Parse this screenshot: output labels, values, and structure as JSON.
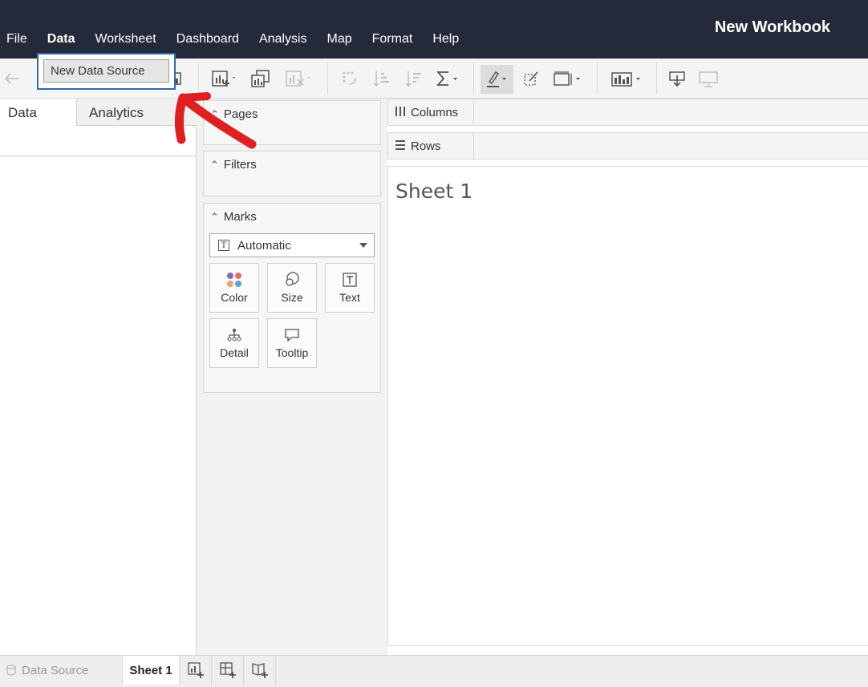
{
  "app": {
    "workbook_title": "New Workbook"
  },
  "menu": {
    "items": [
      {
        "label": "File",
        "active": false
      },
      {
        "label": "Data",
        "active": true
      },
      {
        "label": "Worksheet",
        "active": false
      },
      {
        "label": "Dashboard",
        "active": false
      },
      {
        "label": "Analysis",
        "active": false
      },
      {
        "label": "Map",
        "active": false
      },
      {
        "label": "Format",
        "active": false
      },
      {
        "label": "Help",
        "active": false
      }
    ]
  },
  "dropdown": {
    "item_label": "New Data Source"
  },
  "leftpane": {
    "tab_data": "Data",
    "tab_analytics": "Analytics"
  },
  "cards": {
    "pages": "Pages",
    "filters": "Filters",
    "marks": "Marks",
    "marks_type": "Automatic",
    "mark_buttons": [
      {
        "label": "Color",
        "icon": "color-dots-icon"
      },
      {
        "label": "Size",
        "icon": "size-circles-icon"
      },
      {
        "label": "Text",
        "icon": "text-box-icon"
      },
      {
        "label": "Detail",
        "icon": "detail-hierarchy-icon"
      },
      {
        "label": "Tooltip",
        "icon": "tooltip-bubble-icon"
      }
    ]
  },
  "shelves": {
    "columns": "Columns",
    "rows": "Rows"
  },
  "canvas": {
    "sheet_title": "Sheet 1"
  },
  "bottom": {
    "data_source_tab": "Data Source",
    "sheet_tab": "Sheet 1"
  },
  "colors": {
    "topbar": "#242a3a",
    "dropdown_border": "#2d6cb4",
    "annotation_arrow": "#e02020",
    "color_dots": [
      "#7a6fb5",
      "#e26d6d",
      "#f0a36a",
      "#5fa0d6"
    ]
  }
}
